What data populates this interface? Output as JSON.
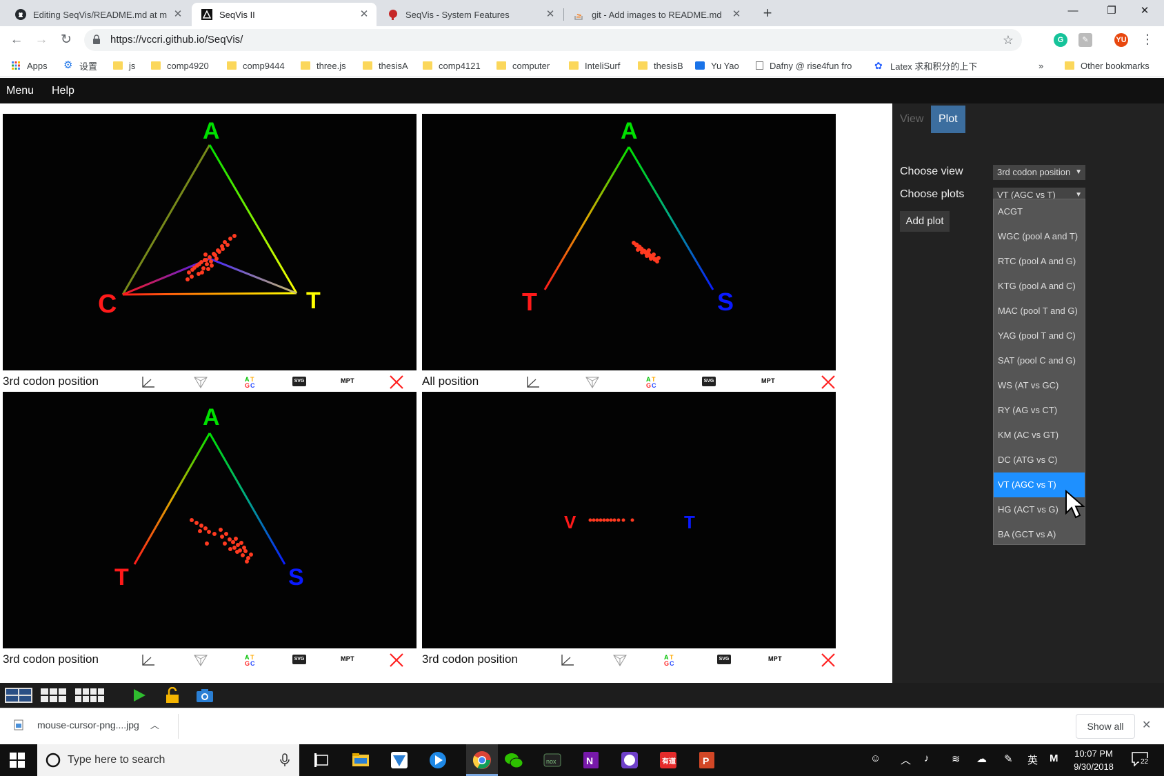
{
  "browser": {
    "tabs": [
      {
        "title": "Editing SeqVis/README.md at m",
        "active": false
      },
      {
        "title": "SeqVis II",
        "active": true
      },
      {
        "title": "SeqVis - System Features",
        "active": false
      },
      {
        "title": "git - Add images to README.md",
        "active": false
      }
    ],
    "url": "https://vccri.github.io/SeqVis/",
    "bookmarks": [
      "Apps",
      "设置",
      "js",
      "comp4920",
      "comp9444",
      "three.js",
      "thesisA",
      "comp4121",
      "computer",
      "InteliSurf",
      "thesisB",
      "Yu Yao",
      "Dafny @ rise4fun fro",
      "Latex 求和积分的上下"
    ],
    "more_bookmarks": "»",
    "other_bookmarks": "Other bookmarks",
    "profile_initials": "YU"
  },
  "menubar": {
    "menu": "Menu",
    "help": "Help"
  },
  "panels": [
    {
      "title": "3rd codon position",
      "labels": [
        "A",
        "C",
        "T"
      ]
    },
    {
      "title": "All position",
      "labels": [
        "A",
        "T",
        "S"
      ]
    },
    {
      "title": "3rd codon position",
      "labels": [
        "A",
        "T",
        "S"
      ]
    },
    {
      "title": "3rd codon position",
      "labels": [
        "V",
        "T"
      ]
    }
  ],
  "panel_tools": {
    "mpt": "MPT",
    "svg": "SVG",
    "atgc": [
      "A",
      "T",
      "G",
      "C"
    ]
  },
  "colors": {
    "green": "#00e000",
    "red": "#ff1a1a",
    "yellow": "#ffff00",
    "blue": "#0a1aff",
    "dots": "#ff3a20",
    "accent": "#3c6e9f",
    "selected": "#1e90ff"
  },
  "right_panel": {
    "tabs": [
      "View",
      "Plot"
    ],
    "active_tab": "Plot",
    "choose_view_label": "Choose view",
    "choose_view_value": "3rd codon position",
    "choose_plots_label": "Choose plots",
    "choose_plots_value": "VT (AGC vs T)",
    "add_plot": "Add plot",
    "dropdown_options": [
      "ACGT",
      "WGC (pool A and T)",
      "RTC (pool A and G)",
      "KTG (pool A and C)",
      "MAC (pool T and G)",
      "YAG (pool T and C)",
      "SAT (pool C and G)",
      "WS (AT vs GC)",
      "RY (AG vs CT)",
      "KM (AC vs GT)",
      "DC (ATG vs C)",
      "VT (AGC vs T)",
      "HG (ACT vs G)",
      "BA (GCT vs A)"
    ],
    "selected_option": "VT (AGC vs T)"
  },
  "downloads": {
    "file": "mouse-cursor-png....jpg",
    "show_all": "Show all"
  },
  "taskbar": {
    "search_placeholder": "Type here to search",
    "time": "10:07 PM",
    "date": "9/30/2018",
    "notifications": "22",
    "ime": "英"
  }
}
